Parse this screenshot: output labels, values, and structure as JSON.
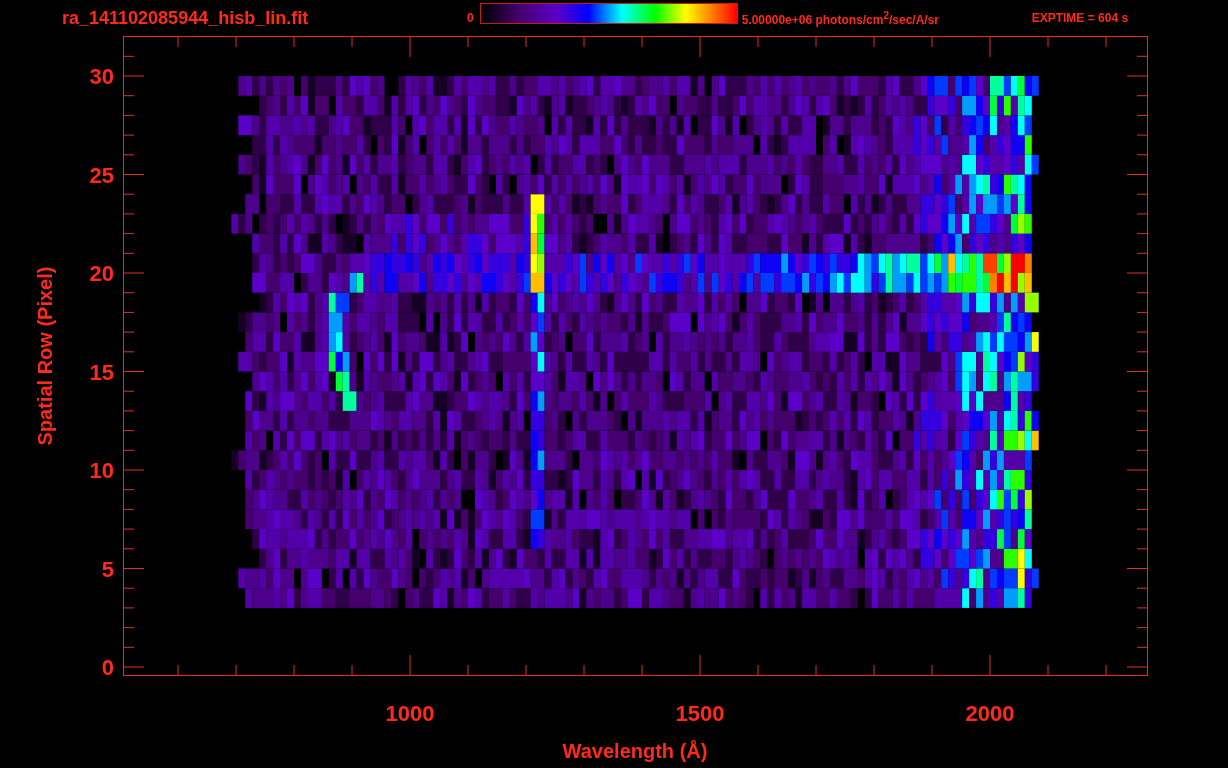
{
  "title": "ra_141102085944_hisb_lin.fit",
  "colorbar": {
    "min_label": "0",
    "max_label": "5.00000e+06 photons/cm$^{2}$/sec/A/sr"
  },
  "exptime": "EXPTIME = 604 s",
  "y_axis": {
    "label": "Spatial Row (Pixel)",
    "ticks": [
      "30",
      "25",
      "20",
      "15",
      "10",
      "5",
      "0"
    ]
  },
  "x_axis": {
    "label": "Wavelength (Å)",
    "ticks": [
      "1000",
      "1500",
      "2000"
    ]
  }
}
